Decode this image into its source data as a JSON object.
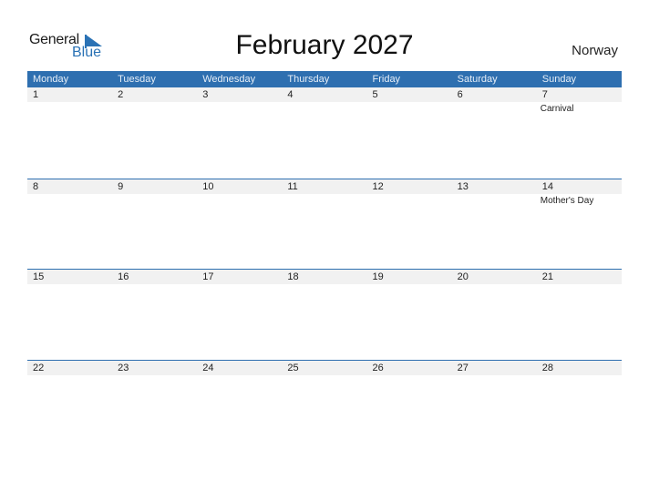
{
  "logo": {
    "general": "General",
    "blue": "Blue"
  },
  "title": "February 2027",
  "country": "Norway",
  "weekdays": [
    "Monday",
    "Tuesday",
    "Wednesday",
    "Thursday",
    "Friday",
    "Saturday",
    "Sunday"
  ],
  "weeks": [
    {
      "days": [
        {
          "n": "1",
          "e": ""
        },
        {
          "n": "2",
          "e": ""
        },
        {
          "n": "3",
          "e": ""
        },
        {
          "n": "4",
          "e": ""
        },
        {
          "n": "5",
          "e": ""
        },
        {
          "n": "6",
          "e": ""
        },
        {
          "n": "7",
          "e": "Carnival"
        }
      ]
    },
    {
      "days": [
        {
          "n": "8",
          "e": ""
        },
        {
          "n": "9",
          "e": ""
        },
        {
          "n": "10",
          "e": ""
        },
        {
          "n": "11",
          "e": ""
        },
        {
          "n": "12",
          "e": ""
        },
        {
          "n": "13",
          "e": ""
        },
        {
          "n": "14",
          "e": "Mother's Day"
        }
      ]
    },
    {
      "days": [
        {
          "n": "15",
          "e": ""
        },
        {
          "n": "16",
          "e": ""
        },
        {
          "n": "17",
          "e": ""
        },
        {
          "n": "18",
          "e": ""
        },
        {
          "n": "19",
          "e": ""
        },
        {
          "n": "20",
          "e": ""
        },
        {
          "n": "21",
          "e": ""
        }
      ]
    },
    {
      "days": [
        {
          "n": "22",
          "e": ""
        },
        {
          "n": "23",
          "e": ""
        },
        {
          "n": "24",
          "e": ""
        },
        {
          "n": "25",
          "e": ""
        },
        {
          "n": "26",
          "e": ""
        },
        {
          "n": "27",
          "e": ""
        },
        {
          "n": "28",
          "e": ""
        }
      ]
    }
  ]
}
